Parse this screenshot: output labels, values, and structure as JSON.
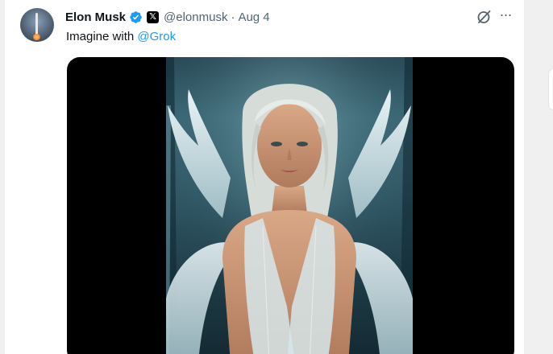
{
  "tweet": {
    "author_name": "Elon Musk",
    "verified_icon": "verified-badge-icon",
    "affiliation_icon": "x-logo-icon",
    "affiliation_glyph": "𝕏",
    "handle": "@elonmusk",
    "separator": "·",
    "date": "Aug 4",
    "text_prefix": "Imagine with ",
    "mention": "@Grok",
    "grok_icon": "grok-icon",
    "more_icon": "more-options-icon",
    "more_glyph": "···",
    "media_description_icon": "angel-photo-image"
  },
  "colors": {
    "link": "#1d9bf0",
    "verified": "#1d9bf0",
    "secondary_text": "#536471",
    "media_background": "#000000"
  }
}
